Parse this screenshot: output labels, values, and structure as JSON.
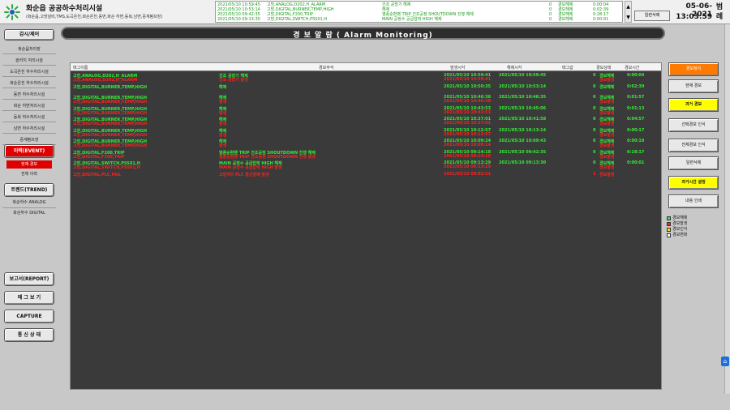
{
  "header": {
    "title": "화순읍 공공하수처리시설",
    "subtitle": "(화순읍,고방설비,TMS,도곡온천,화순온천,동면,화순 하변,동복,남면,중계펌프장)",
    "date": "05-06-2021",
    "time": "13:03:59",
    "lang_label": "범례",
    "ack_all_label": "일련삭제"
  },
  "ticker": [
    {
      "time": "2021/05/10 10:59:45",
      "tag": "고방,ANALOG,D202,H_ALARM",
      "desc": "건조 공방기 해제",
      "val": "0",
      "status": "경보해제",
      "dur": "0:00:04"
    },
    {
      "time": "2021/05/10 10:53:14",
      "tag": "고방,DIGITAL,BURNER,TEMP,HIGH",
      "desc": "해제",
      "val": "0",
      "status": "경보해제",
      "dur": "0:02:39"
    },
    {
      "time": "2021/05/10 09:42:35",
      "tag": "고방,DIGITAL,F200,TRIP",
      "desc": "열풍순환팬 TRIP 건조공정 SHOUTDOWN 진행 해제",
      "val": "0",
      "status": "경보해제",
      "dur": "0:28:17"
    },
    {
      "time": "2021/05/10 09:13:30",
      "tag": "고방,DIGITAL,SWITCH,PSS01,H",
      "desc": "MAIN 공정수 공급압력 HIGH 해제",
      "val": "0",
      "status": "경보해제",
      "dur": "0:00:01"
    }
  ],
  "sidebar": {
    "monitor_label": "감시/제어",
    "sub_items": [
      "화순읍처리장",
      "슬러지 처리시설",
      "도곡온천 하수처리시설",
      "화순온천 하수처리시설",
      "동면 하수처리시설",
      "화순 하변처리시설",
      "동복 하수처리시설",
      "남면 하수처리시설",
      "중계펌프장"
    ],
    "event_label": "이력(EVENT)",
    "event_sub": [
      "현재 경보",
      "전체 이력"
    ],
    "trend_label": "트렌드(TREND)",
    "trend_sub": [
      "화순하수 ANALOG",
      "화순하수 DIGITAL"
    ],
    "report_label": "보고서(REPORT)",
    "memo_label": "메 그 보 기",
    "capture_label": "CAPTURE",
    "comm_label": "통 신 상 태"
  },
  "main": {
    "title": "경 보 알 람 ( Alarm Monitoring)",
    "columns": {
      "tag": "태그이름",
      "desc": "경보주석",
      "occur": "발생시각",
      "clear": "해제시각",
      "value": "태그값",
      "state": "경보상태",
      "dur": "경보시간"
    },
    "rows": [
      {
        "tag": "고방,ANALOG,D202,H_ALARM",
        "desc": "건조 공방기 해제",
        "occur": "2021/05/10 10:59:41",
        "clear": "2021/05/10 10:59:45",
        "val": "0",
        "state": "경보해제",
        "dur": "0:00:04",
        "color": "g",
        "sub_tag": "고방,ANALOG,D202,H_ALARM",
        "sub_desc": "건조 공방기 발생",
        "sub_occur": "2021/05/10 10:59:41",
        "sub_state": "경보발생"
      },
      {
        "tag": "고방,DIGITAL,BURNER,TEMP,HIGH",
        "desc": "해제",
        "occur": "2021/05/10 10:50:35",
        "clear": "2021/05/10 10:53:14",
        "val": "0",
        "state": "경보해제",
        "dur": "0:02:39",
        "color": "g"
      },
      {
        "tag": "고방,DIGITAL,BURNER,TEMP,HIGH",
        "desc": "해제",
        "occur": "2021/05/10 10:46:38",
        "clear": "2021/05/10 10:48:35",
        "val": "0",
        "state": "경보해제",
        "dur": "0:01:57",
        "color": "g",
        "sub_tag": "고방,DIGITAL,BURNER,TEMP,HIGH",
        "sub_desc": "발생",
        "sub_occur": "2021/05/10 10:46:38",
        "sub_state": "경보발생"
      },
      {
        "tag": "고방,DIGITAL,BURNER,TEMP,HIGH",
        "desc": "해제",
        "occur": "2021/05/10 10:43:53",
        "clear": "2021/05/10 10:45:06",
        "val": "0",
        "state": "경보해제",
        "dur": "0:01:13",
        "color": "g",
        "sub_tag": "고방,DIGITAL,BURNER,TEMP,HIGH",
        "sub_desc": "발생",
        "sub_occur": "2021/05/10 10:43:53",
        "sub_state": "경보발생"
      },
      {
        "tag": "고방,DIGITAL,BURNER,TEMP,HIGH",
        "desc": "해제",
        "occur": "2021/05/10 10:37:01",
        "clear": "2021/05/10 10:41:58",
        "val": "0",
        "state": "경보해제",
        "dur": "0:04:57",
        "color": "g",
        "sub_tag": "고방,DIGITAL,BURNER,TEMP,HIGH",
        "sub_desc": "발생",
        "sub_occur": "2021/05/10 10:37:01",
        "sub_state": "경보발생"
      },
      {
        "tag": "고방,DIGITAL,BURNER,TEMP,HIGH",
        "desc": "해제",
        "occur": "2021/05/10 10:12:57",
        "clear": "2021/05/10 10:13:14",
        "val": "0",
        "state": "경보해제",
        "dur": "0:00:17",
        "color": "g",
        "sub_tag": "고방,DIGITAL,BURNER,TEMP,HIGH",
        "sub_desc": "발생",
        "sub_occur": "2021/05/10 10:12:57",
        "sub_state": "경보발생"
      },
      {
        "tag": "고방,DIGITAL,BURNER,TEMP,HIGH",
        "desc": "해제",
        "occur": "2021/05/10 10:09:24",
        "clear": "2021/05/10 10:09:43",
        "val": "0",
        "state": "경보해제",
        "dur": "0:00:19",
        "color": "g",
        "sub_tag": "고방,DIGITAL,BURNER,TEMP,HIGH",
        "sub_desc": "발생",
        "sub_occur": "2021/05/10 10:09:24",
        "sub_state": "경보발생"
      },
      {
        "tag": "고방,DIGITAL,F200,TRIP",
        "desc": "열풍순환팬 TRIP 건조공정 SHOUTDOWN 진행 해제",
        "occur": "2021/05/10 09:14:18",
        "clear": "2021/05/10 09:42:35",
        "val": "0",
        "state": "경보해제",
        "dur": "0:28:17",
        "color": "g",
        "sub_tag": "고방,DIGITAL,F200,TRIP",
        "sub_desc": "열풍순환팬 TRIP 건조공정 SHOUTDOWN 진행 발생",
        "sub_occur": "2021/05/10 09:14:18",
        "sub_state": "경보발생"
      },
      {
        "tag": "고방,DIGITAL,SWITCH,PSS01,H",
        "desc": "MAIN 공정수 공급압력 HIGH 해제",
        "occur": "2021/05/10 09:13:29",
        "clear": "2021/05/10 09:13:30",
        "val": "0",
        "state": "경보해제",
        "dur": "0:00:01",
        "color": "g",
        "sub_tag": "고방,DIGITAL,SWITCH,PSS01,H",
        "sub_desc": "MAIN 공정수 공급압력 HIGH 발생",
        "sub_occur": "2021/05/10 09:13:29",
        "sub_state": "경보발생"
      },
      {
        "tag": "고방,DIGITAL,PLC,FAIL",
        "desc": "고방처리 PLC 통신장애 발생",
        "occur": "2021/05/10 09:02:11",
        "clear": "",
        "val": "1",
        "state": "경보발생",
        "dur": "",
        "color": "r"
      }
    ]
  },
  "right": {
    "buttons": [
      "경보정지",
      "현재 경보",
      "과거 경보",
      "선택경보 인식",
      "전체경보 인식",
      "일련삭제",
      "과거시간 설정",
      "내용 인쇄"
    ],
    "legend": [
      "경보해제",
      "경보발생",
      "경보인식",
      "경보변화"
    ]
  },
  "colors": {
    "legend": [
      "#33ee33",
      "#ff2020",
      "#f0e000",
      "#ffffff"
    ]
  }
}
